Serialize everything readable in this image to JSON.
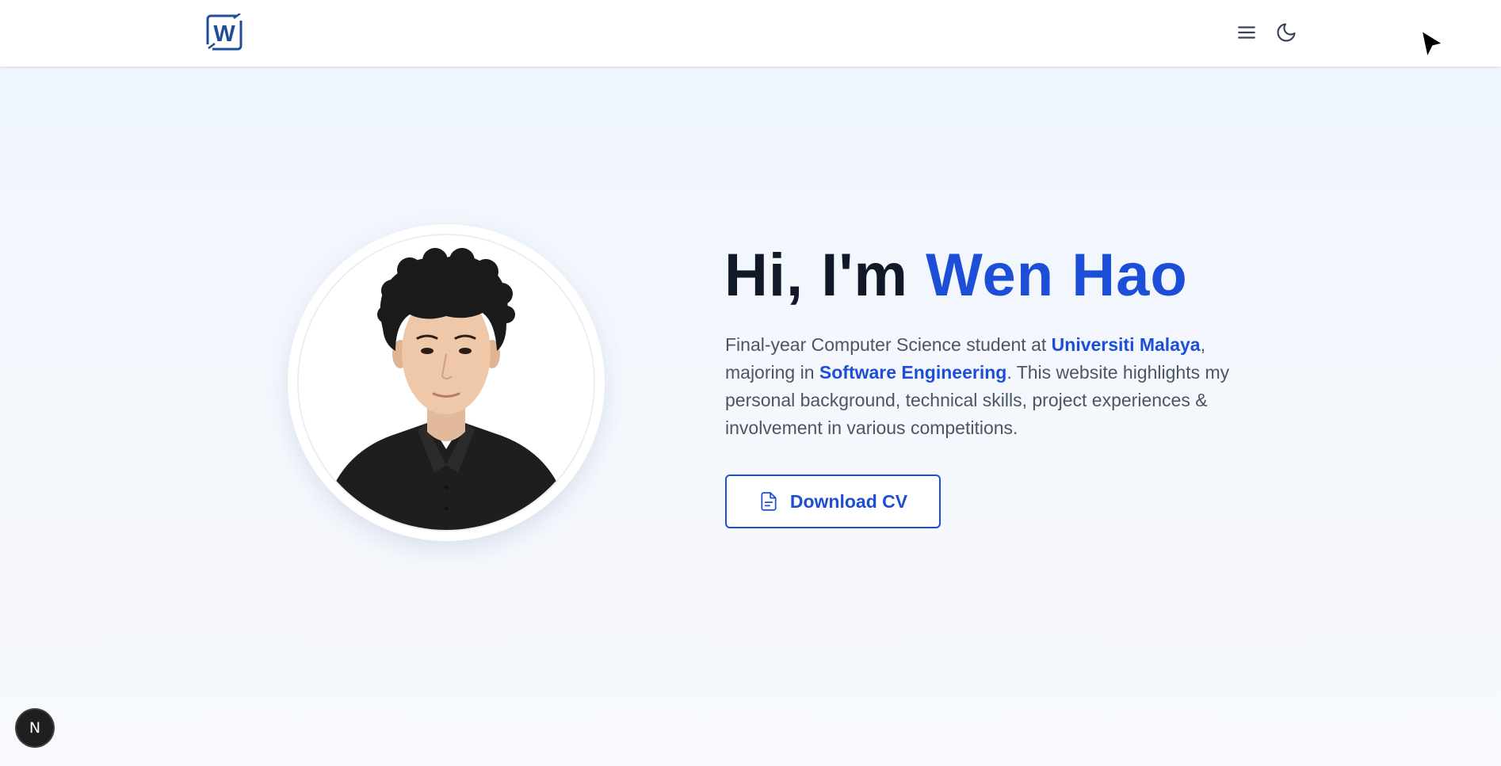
{
  "header": {
    "logo_letter": "W",
    "logo_icon": "w-logo-icon",
    "menu_icon": "menu-icon",
    "theme_icon": "moon-icon"
  },
  "hero": {
    "greeting": "Hi, I'm ",
    "name": "Wen Hao",
    "desc_part1": "Final-year Computer Science student at ",
    "university": "Universiti Malaya",
    "desc_part2": ", majoring in ",
    "major": "Software Engineering",
    "desc_part3": ". This website highlights my personal background, technical skills, project experiences & involvement in various competitions.",
    "cv_button_label": "Download CV",
    "cv_button_icon": "document-icon"
  },
  "badge": {
    "label": "N",
    "icon": "nextjs-icon"
  },
  "colors": {
    "accent": "#1d4ed8",
    "heading": "#111827",
    "body_text": "#4b5563",
    "background": "#eff5fd"
  }
}
